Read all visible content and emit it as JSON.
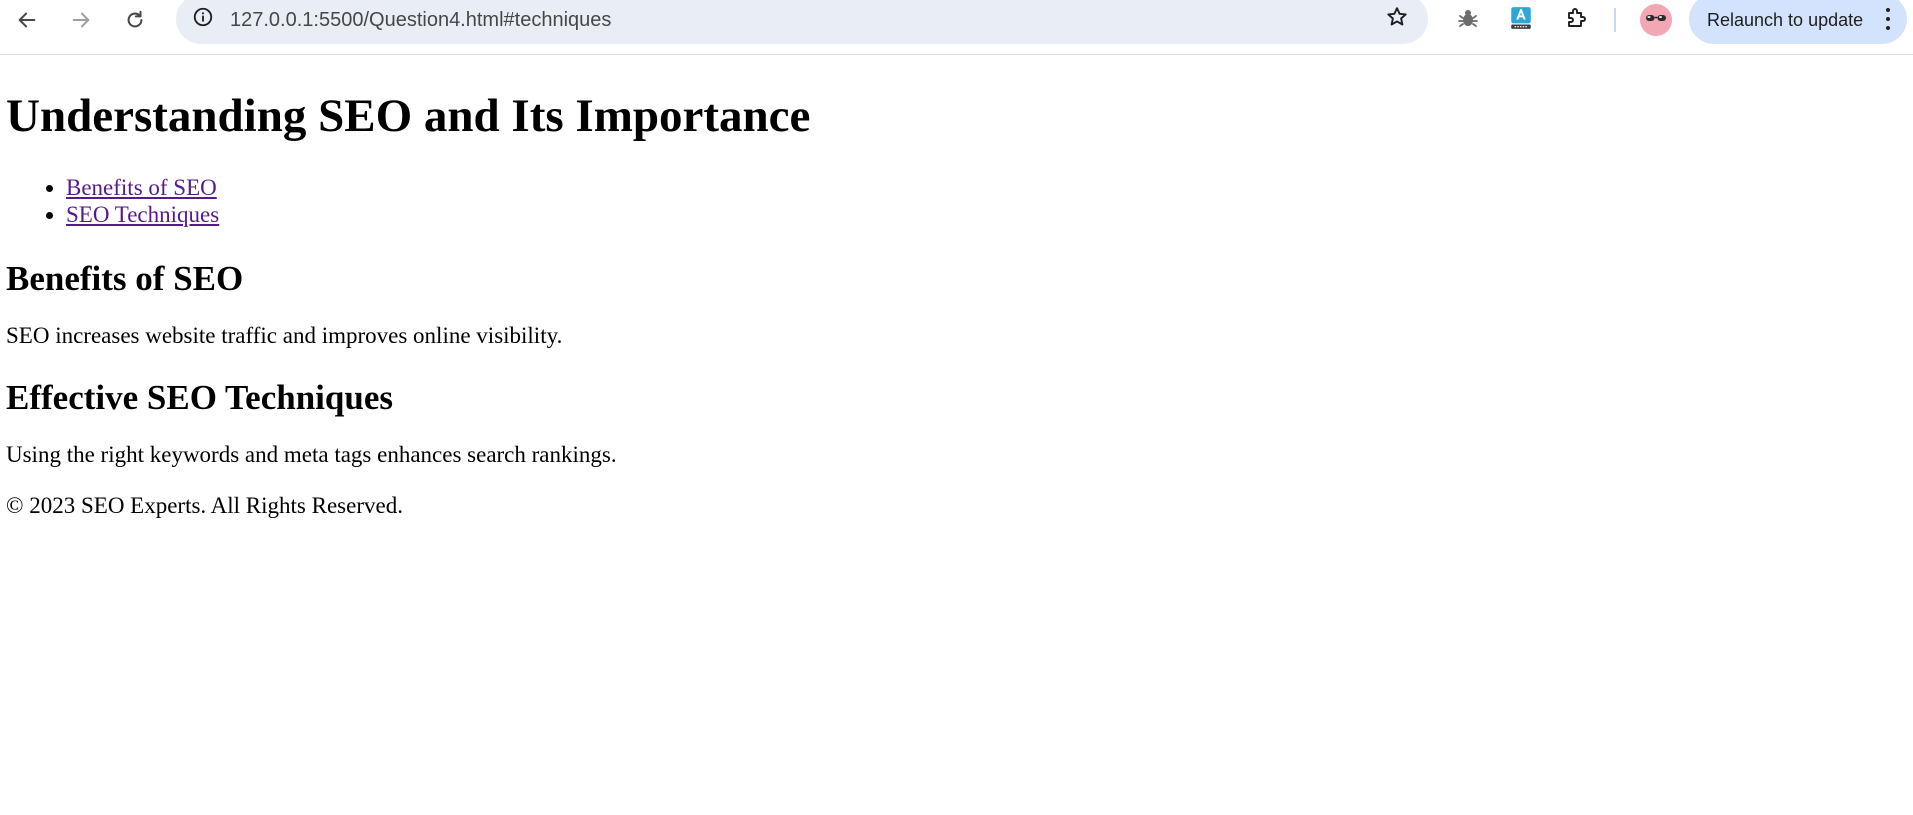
{
  "browser": {
    "url": "127.0.0.1:5500/Question4.html#techniques",
    "relaunch_label": "Relaunch to update",
    "icons": {
      "back": "arrow-left-icon",
      "forward": "arrow-right-icon",
      "reload": "reload-icon",
      "site_info": "info-icon",
      "bookmark": "star-icon",
      "extension_1": "bug-icon",
      "extension_2": "translate-icon",
      "extensions": "puzzle-icon",
      "profile": "avatar-sunglasses",
      "menu": "more-vertical-icon"
    }
  },
  "page": {
    "title": "Understanding SEO and Its Importance",
    "nav_links": [
      {
        "label": "Benefits of SEO"
      },
      {
        "label": "SEO Techniques"
      }
    ],
    "sections": [
      {
        "heading": "Benefits of SEO",
        "text": "SEO increases website traffic and improves online visibility."
      },
      {
        "heading": "Effective SEO Techniques",
        "text": "Using the right keywords and meta tags enhances search rankings."
      }
    ],
    "footer": "© 2023 SEO Experts. All Rights Reserved."
  },
  "colors": {
    "link_visited": "#551a8b",
    "omnibox_bg": "#e9eef6",
    "relaunch_bg": "#d3e3fd"
  }
}
